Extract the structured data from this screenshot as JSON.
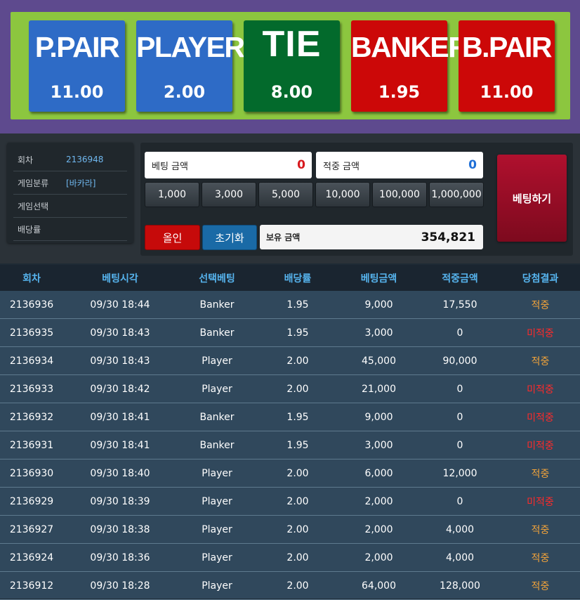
{
  "odds": [
    {
      "name": "P.PAIR",
      "value": "11.00",
      "color": "#2e6bc6"
    },
    {
      "name": "PLAYER",
      "value": "2.00",
      "color": "#2e6bc6"
    },
    {
      "name": "TIE",
      "value": "8.00",
      "color": "#036a2c"
    },
    {
      "name": "BANKER",
      "value": "1.95",
      "color": "#cc0808"
    },
    {
      "name": "B.PAIR",
      "value": "11.00",
      "color": "#cc0808"
    }
  ],
  "info": {
    "round_label": "회차",
    "round_value": "2136948",
    "category_label": "게임분류",
    "category_value": "[바카라]",
    "selection_label": "게임선택",
    "selection_value": "",
    "payout_label": "배당률",
    "payout_value": ""
  },
  "bet": {
    "bet_amount_label": "베팅 금액",
    "bet_amount_value": "0",
    "win_amount_label": "적중 금액",
    "win_amount_value": "0",
    "chips": [
      "1,000",
      "3,000",
      "5,000",
      "10,000",
      "100,000",
      "1,000,000"
    ],
    "allin_label": "올인",
    "reset_label": "초기화",
    "balance_label": "보유 금액",
    "balance_value": "354,821",
    "submit_label": "베팅하기"
  },
  "history": {
    "headers": [
      "회차",
      "베팅시각",
      "선택베팅",
      "배당률",
      "베팅금액",
      "적중금액",
      "당첨결과"
    ],
    "rows": [
      [
        "2136936",
        "09/30 18:44",
        "Banker",
        "1.95",
        "9,000",
        "17,550",
        "적중"
      ],
      [
        "2136935",
        "09/30 18:43",
        "Banker",
        "1.95",
        "3,000",
        "0",
        "미적중"
      ],
      [
        "2136934",
        "09/30 18:43",
        "Player",
        "2.00",
        "45,000",
        "90,000",
        "적중"
      ],
      [
        "2136933",
        "09/30 18:42",
        "Player",
        "2.00",
        "21,000",
        "0",
        "미적중"
      ],
      [
        "2136932",
        "09/30 18:41",
        "Banker",
        "1.95",
        "9,000",
        "0",
        "미적중"
      ],
      [
        "2136931",
        "09/30 18:41",
        "Banker",
        "1.95",
        "3,000",
        "0",
        "미적중"
      ],
      [
        "2136930",
        "09/30 18:40",
        "Player",
        "2.00",
        "6,000",
        "12,000",
        "적중"
      ],
      [
        "2136929",
        "09/30 18:39",
        "Player",
        "2.00",
        "2,000",
        "0",
        "미적중"
      ],
      [
        "2136927",
        "09/30 18:38",
        "Player",
        "2.00",
        "2,000",
        "4,000",
        "적중"
      ],
      [
        "2136924",
        "09/30 18:36",
        "Player",
        "2.00",
        "2,000",
        "4,000",
        "적중"
      ],
      [
        "2136912",
        "09/30 18:28",
        "Player",
        "2.00",
        "64,000",
        "128,000",
        "적중"
      ]
    ]
  }
}
